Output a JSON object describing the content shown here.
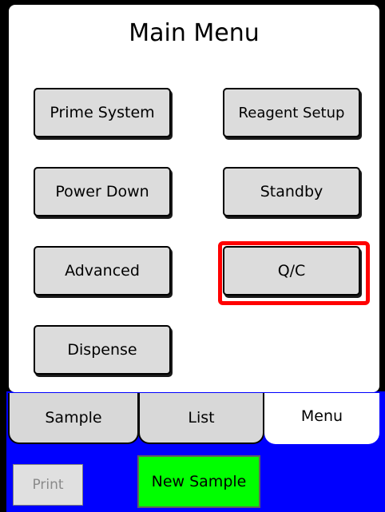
{
  "header": {
    "title": "Main Menu"
  },
  "menu": {
    "prime_system": "Prime System",
    "reagent_setup": "Reagent Setup",
    "power_down": "Power Down",
    "standby": "Standby",
    "advanced": "Advanced",
    "qc": "Q/C",
    "dispense": "Dispense"
  },
  "tabs": {
    "sample": "Sample",
    "list": "List",
    "menu": "Menu",
    "active": "Menu"
  },
  "actions": {
    "print": "Print",
    "new_sample": "New Sample"
  },
  "colors": {
    "background": "#0000ff",
    "new_sample": "#00ff00",
    "highlight": "#ff0000",
    "button": "#dcdcdc"
  }
}
